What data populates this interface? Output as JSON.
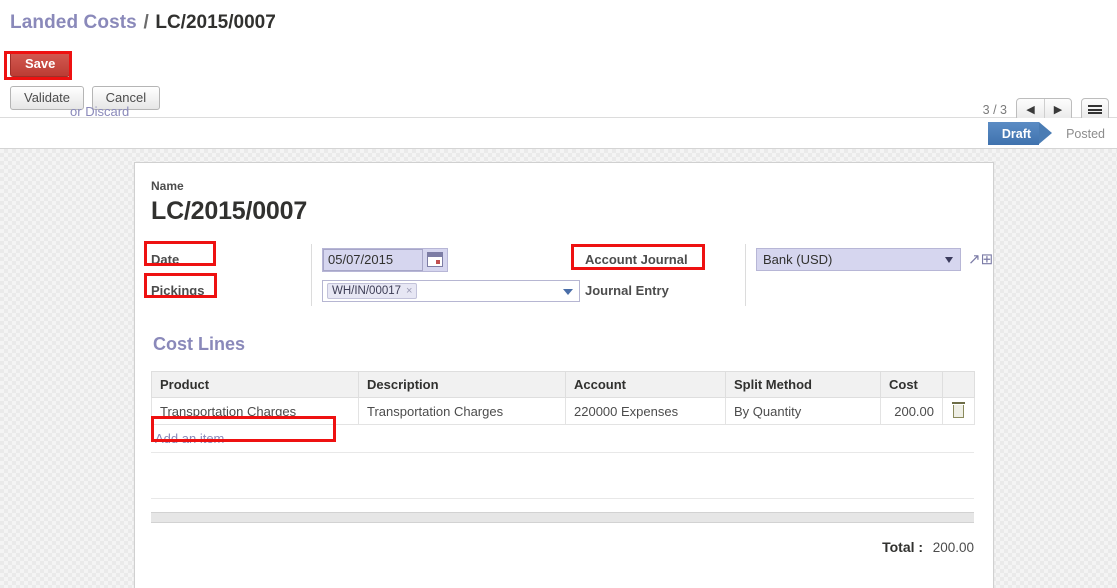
{
  "breadcrumb": {
    "root": "Landed Costs",
    "separator": "/",
    "current": "LC/2015/0007"
  },
  "actions": {
    "save_label": "Save",
    "or_text": "or",
    "discard_label": "Discard",
    "validate_label": "Validate",
    "cancel_label": "Cancel"
  },
  "pager": {
    "count": "3 / 3",
    "prev_icon": "arrow-left-icon",
    "next_icon": "arrow-right-icon",
    "menu_icon": "hamburger-menu-icon"
  },
  "statusbar": {
    "items": [
      {
        "label": "Draft",
        "active": true
      },
      {
        "label": "Posted",
        "active": false
      }
    ]
  },
  "form": {
    "name_label": "Name",
    "name_value": "LC/2015/0007",
    "date_label": "Date",
    "date_value": "05/07/2015",
    "calendar_icon": "calendar-icon",
    "pickings_label": "Pickings",
    "pickings_tag": "WH/IN/00017",
    "pickings_tag_remove": "×",
    "account_journal_label": "Account Journal",
    "account_journal_value": "Bank (USD)",
    "external_link_icon": "external-link-icon",
    "journal_entry_label": "Journal Entry"
  },
  "cost_lines": {
    "section_title": "Cost Lines",
    "columns": [
      "Product",
      "Description",
      "Account",
      "Split Method",
      "Cost"
    ],
    "rows": [
      {
        "product": "Transportation Charges",
        "description": "Transportation Charges",
        "account": "220000 Expenses",
        "split_method": "By Quantity",
        "cost": "200.00",
        "delete_icon": "trash-icon"
      }
    ],
    "add_item_label": "Add an item",
    "total_label": "Total :",
    "total_value": "200.00"
  },
  "colors": {
    "accent_purple": "#8a89ba",
    "save_red": "#c9473f",
    "annotation_red": "#ee1111",
    "status_blue": "#4d7fb8",
    "field_lavender": "#d6d6ef"
  }
}
